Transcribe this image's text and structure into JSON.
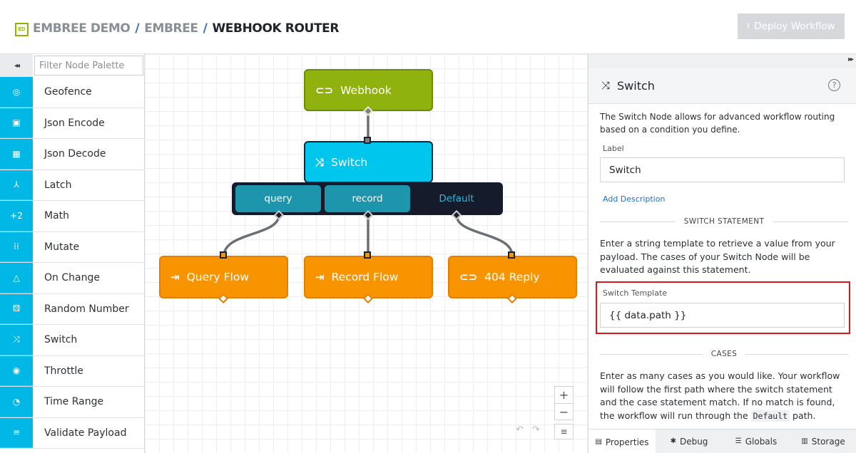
{
  "header": {
    "logo_text": "ED",
    "breadcrumb": [
      "EMBREE DEMO",
      "EMBREE"
    ],
    "separator": "/",
    "current": "WEBHOOK ROUTER",
    "deploy_button": "Deploy Workflow",
    "deploy_icon": "upload-icon"
  },
  "palette": {
    "collapse_icon": "◂◂",
    "filter_placeholder": "Filter Node Palette",
    "items": [
      {
        "label": "Geofence",
        "icon": "◎"
      },
      {
        "label": "Json Encode",
        "icon": "▣"
      },
      {
        "label": "Json Decode",
        "icon": "▦"
      },
      {
        "label": "Latch",
        "icon": "⅄"
      },
      {
        "label": "Math",
        "icon": "+2"
      },
      {
        "label": "Mutate",
        "icon": "⁞⁞"
      },
      {
        "label": "On Change",
        "icon": "△"
      },
      {
        "label": "Random Number",
        "icon": "⚄"
      },
      {
        "label": "Switch",
        "icon": "⤨"
      },
      {
        "label": "Throttle",
        "icon": "◉"
      },
      {
        "label": "Time Range",
        "icon": "◔"
      },
      {
        "label": "Validate Payload",
        "icon": "≡"
      }
    ]
  },
  "canvas": {
    "nodes": {
      "webhook": {
        "label": "Webhook",
        "icon": "⊂⊃"
      },
      "switch": {
        "label": "Switch",
        "icon": "⤨"
      },
      "query_flow": {
        "label": "Query Flow",
        "icon": "⇥"
      },
      "record_flow": {
        "label": "Record Flow",
        "icon": "⇥"
      },
      "reply": {
        "label": "404 Reply",
        "icon": "⊂⊃"
      }
    },
    "cases": {
      "query": "query",
      "record": "record",
      "default": "Default"
    },
    "controls": {
      "zoom_in": "+",
      "zoom_out": "−",
      "undo": "↶",
      "redo": "↷",
      "menu": "≡"
    }
  },
  "panel": {
    "expand_icon": "▸▸",
    "title_icon": "⤨",
    "title": "Switch",
    "help": "?",
    "description": "The Switch Node allows for advanced workflow routing based on a condition you define.",
    "label_field": {
      "label": "Label",
      "value": "Switch"
    },
    "add_description": "Add Description",
    "switch_statement_heading": "SWITCH STATEMENT",
    "switch_statement_text": "Enter a string template to retrieve a value from your payload. The cases of your Switch Node will be evaluated against this statement.",
    "template_field": {
      "label": "Switch Template",
      "value": "{{ data.path }}"
    },
    "cases_heading": "CASES",
    "cases_text_before": "Enter as many cases as you would like. Your workflow will follow the first path where the switch statement and the case statement match. If no match is found, the workflow will run through the ",
    "cases_text_code": "Default",
    "cases_text_after": " path.",
    "tabs": [
      {
        "label": "Properties",
        "icon": "▤"
      },
      {
        "label": "Debug",
        "icon": "✱"
      },
      {
        "label": "Globals",
        "icon": "☰"
      },
      {
        "label": "Storage",
        "icon": "▥"
      }
    ]
  },
  "colors": {
    "accent": "#00b7e5",
    "webhook": "#8fb20e",
    "switch": "#00c6ee",
    "flow": "#f89400",
    "switch_bar": "#161b2b",
    "highlight": "#e0151a"
  }
}
